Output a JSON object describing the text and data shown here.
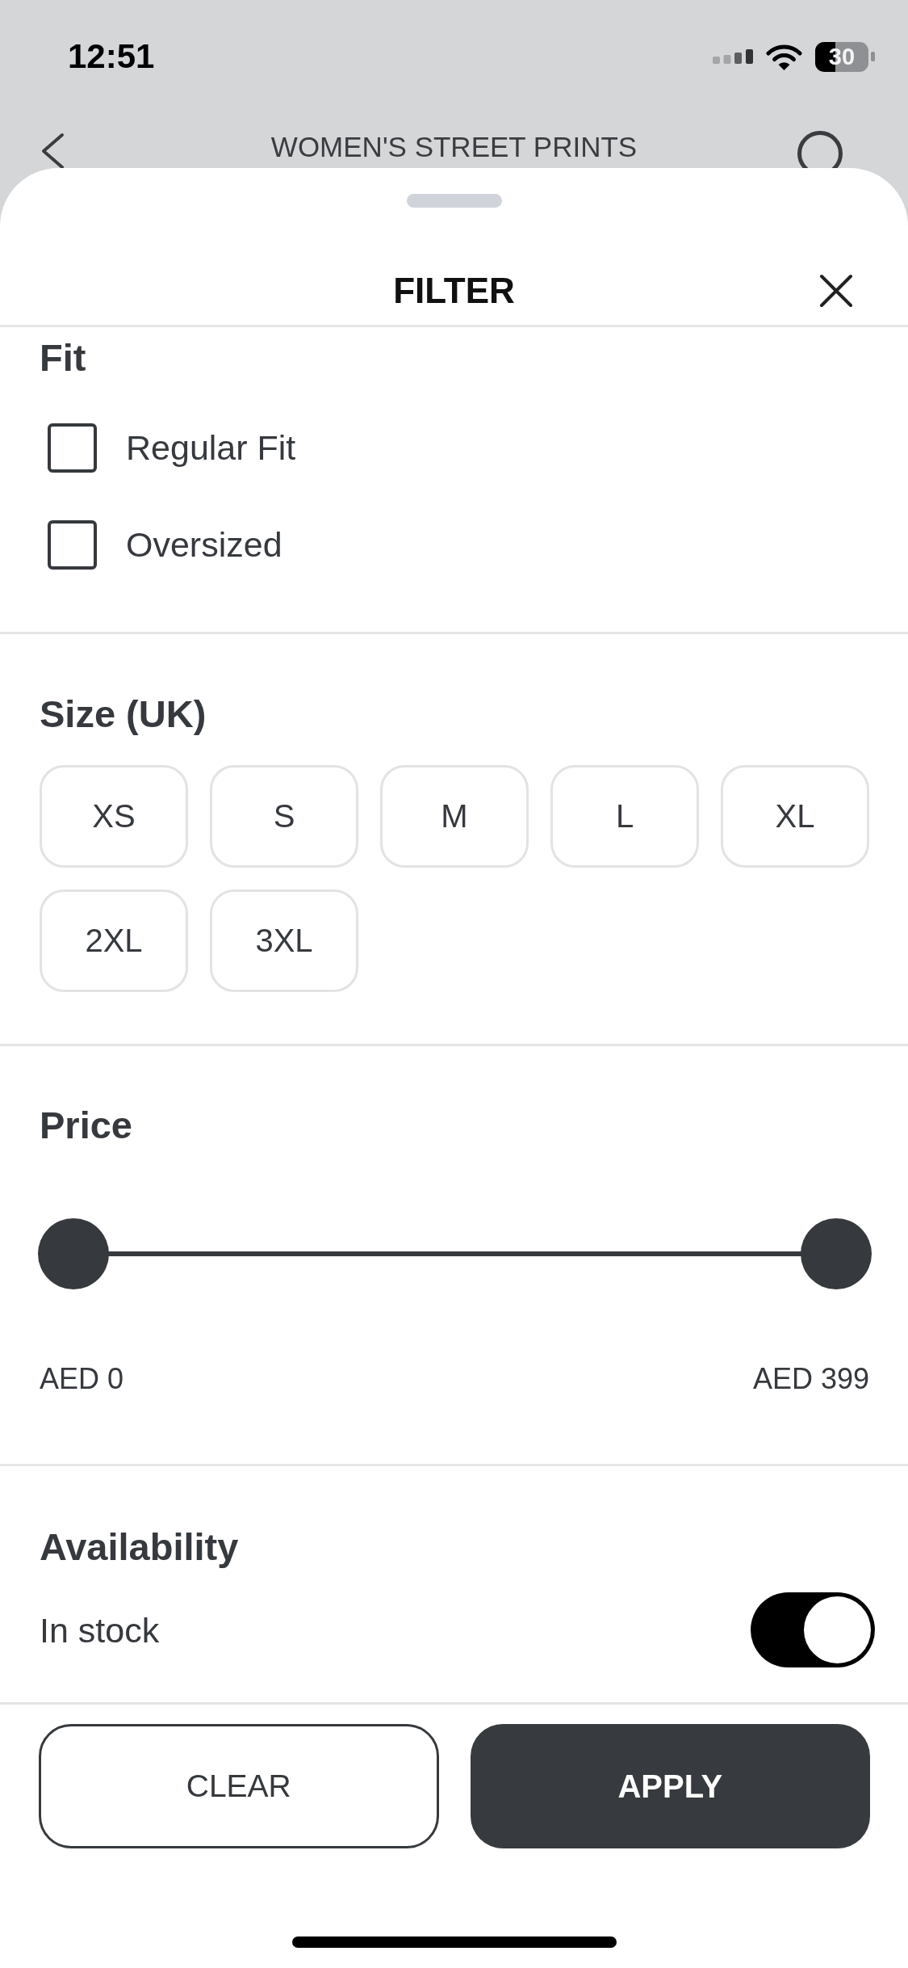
{
  "status_bar": {
    "time": "12:51",
    "battery": "30"
  },
  "nav_bar": {
    "title": "WOMEN'S STREET PRINTS"
  },
  "filter_sheet": {
    "title": "FILTER",
    "sections": [
      {
        "kind": "checkboxes",
        "title": "Fit",
        "options": [
          {
            "label": "Regular Fit",
            "checked": false
          },
          {
            "label": "Oversized",
            "checked": false
          }
        ]
      },
      {
        "kind": "chips",
        "title": "Size (UK)",
        "options": [
          {
            "label": "XS",
            "selected": false
          },
          {
            "label": "S",
            "selected": false
          },
          {
            "label": "M",
            "selected": false
          },
          {
            "label": "L",
            "selected": false
          },
          {
            "label": "XL",
            "selected": false
          },
          {
            "label": "2XL",
            "selected": false
          },
          {
            "label": "3XL",
            "selected": false
          }
        ]
      },
      {
        "kind": "range",
        "title": "Price",
        "thumbs": [
          {
            "level": 0
          },
          {
            "level": 1
          }
        ],
        "min_label": "AED 0",
        "max_label": "AED 399"
      },
      {
        "kind": "toggle",
        "title": "Availability",
        "label": "In stock",
        "on": true
      }
    ],
    "buttons": [
      {
        "label": "CLEAR",
        "kind": "outline"
      },
      {
        "label": "APPLY",
        "kind": "filled"
      }
    ]
  }
}
